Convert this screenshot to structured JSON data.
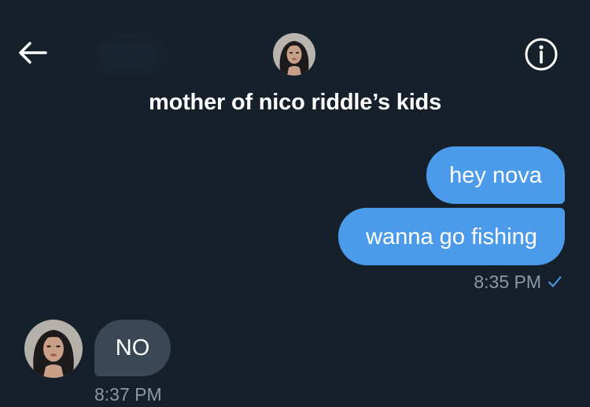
{
  "header": {
    "title": "mother of nico riddle’s kids",
    "back_icon": "arrow-left-icon",
    "info_icon": "info-circle-icon"
  },
  "messages": [
    {
      "direction": "outgoing",
      "text": "hey nova"
    },
    {
      "direction": "outgoing",
      "text": "wanna go fishing"
    },
    {
      "direction": "incoming",
      "text": "NO"
    }
  ],
  "timestamps": {
    "outgoing": "8:35 PM",
    "incoming": "8:37 PM"
  },
  "colors": {
    "background": "#15202b",
    "outgoing_bubble": "#4b9bea",
    "incoming_bubble": "#3a4855",
    "timestamp": "#8b98a5",
    "read_check": "#4b9bea"
  }
}
